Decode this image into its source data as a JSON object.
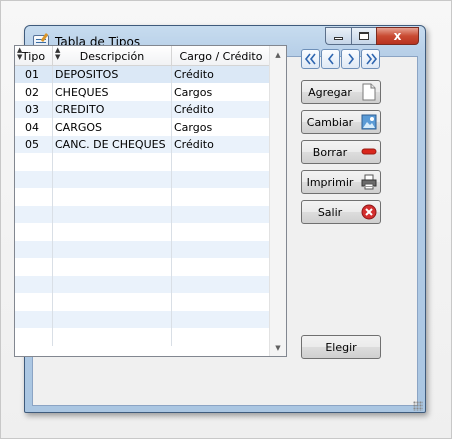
{
  "window": {
    "title": "Tabla de Tipos",
    "controls": {
      "minimize_icon": "minimize-icon",
      "maximize_icon": "maximize-icon",
      "close_icon": "close-icon",
      "close_glyph": "x"
    }
  },
  "grid": {
    "headers": {
      "tipo": "Tipo",
      "descripcion": "Descripción",
      "cargo_credito": "Cargo / Crédito"
    },
    "rows": [
      {
        "tipo": "01",
        "descripcion": "DEPOSITOS",
        "cargo": "Crédito"
      },
      {
        "tipo": "02",
        "descripcion": "CHEQUES",
        "cargo": "Cargos"
      },
      {
        "tipo": "03",
        "descripcion": "CREDITO",
        "cargo": "Crédito"
      },
      {
        "tipo": "04",
        "descripcion": "CARGOS",
        "cargo": "Cargos"
      },
      {
        "tipo": "05",
        "descripcion": "CANC. DE CHEQUES",
        "cargo": "Crédito"
      }
    ],
    "selected_row": 0,
    "empty_row_count": 11
  },
  "nav": {
    "first_icon": "double-chevron-left-icon",
    "prev_icon": "chevron-left-icon",
    "next_icon": "chevron-right-icon",
    "last_icon": "double-chevron-right-icon"
  },
  "buttons": {
    "agregar": "Agregar",
    "cambiar": "Cambiar",
    "borrar": "Borrar",
    "imprimir": "Imprimir",
    "salir": "Salir",
    "elegir": "Elegir"
  },
  "colors": {
    "title_bar": "#b7cfe8",
    "row_alternate": "#eaf2fb",
    "row_selected": "#dbe8f6",
    "delete_icon": "#d9261c",
    "exit_icon": "#d32f2f"
  }
}
